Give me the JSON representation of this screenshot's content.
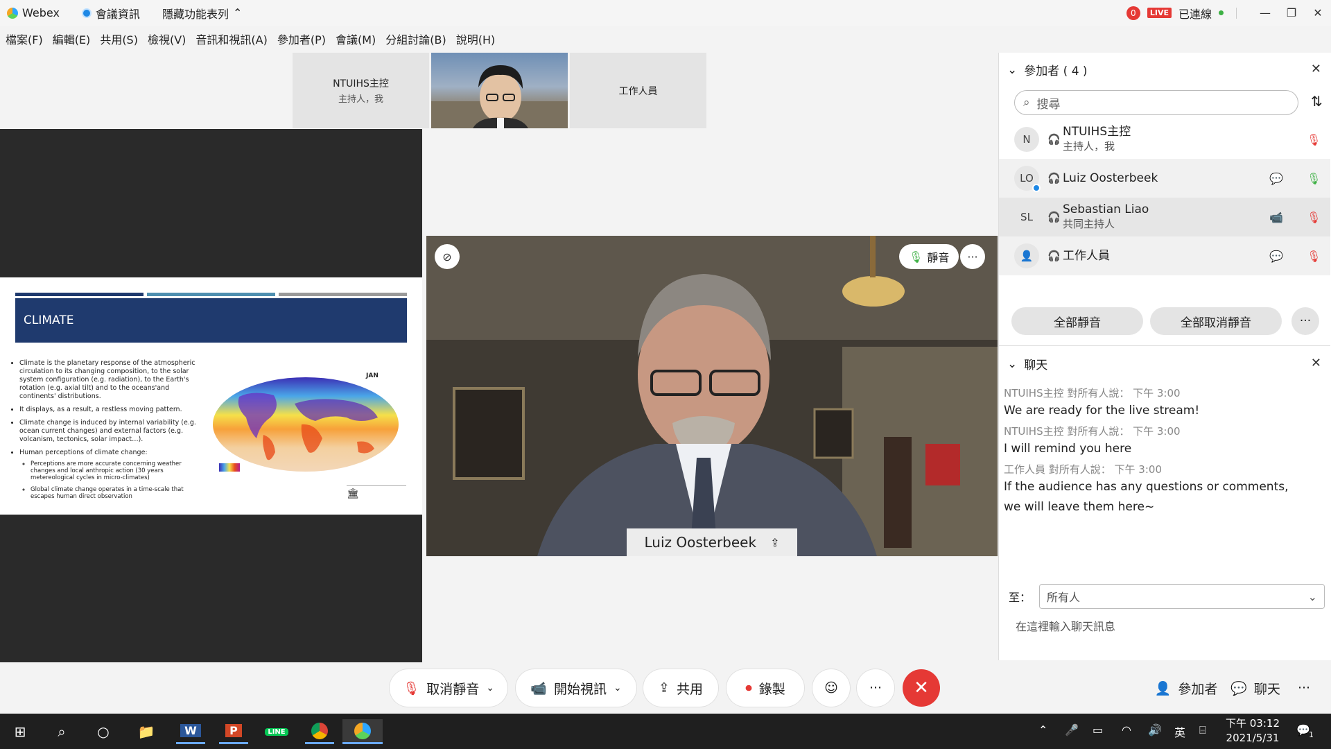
{
  "titlebar": {
    "app": "Webex",
    "meeting_info": "會議資訊",
    "hide_toolbar": "隱藏功能表列",
    "rec_count": "0",
    "live": "LIVE",
    "status": "已連線"
  },
  "menu": [
    "檔案(F)",
    "編輯(E)",
    "共用(S)",
    "檢視(V)",
    "音訊和視訊(A)",
    "參加者(P)",
    "會議(M)",
    "分組討論(B)",
    "說明(H)"
  ],
  "thumbnails": {
    "host_name": "NTUIHS主控",
    "host_sub": "主持人，我",
    "staff": "工作人員"
  },
  "slide": {
    "title": "CLIMATE",
    "bullets": [
      "Climate is the planetary response of the atmospheric circulation to its changing composition, to the solar system configuration (e.g. radiation), to the Earth's rotation (e.g. axial tilt) and to the oceans'and continents' distributions.",
      "It displays, as a result, a restless moving pattern.",
      "Climate change is induced by internal variability (e.g. ocean current changes) and external factors (e.g. volcanism, tectonics, solar impact…).",
      "Human perceptions of climate change:"
    ],
    "sub_bullets": [
      "Perceptions are more accurate concerning weather changes and local anthropic action (30 years metereological cycles in micro-climates)",
      "Global climate change operates in a time-scale that escapes human direct observation"
    ],
    "map_label": "JAN"
  },
  "main_video": {
    "mute_label": "靜音",
    "speaker_name": "Luiz Oosterbeek"
  },
  "participants": {
    "header": "參加者 ( 4 )",
    "search_placeholder": "搜尋",
    "list": [
      {
        "initials": "N",
        "name": "NTUIHS主控",
        "role": "主持人，我"
      },
      {
        "initials": "LO",
        "name": "Luiz Oosterbeek",
        "role": ""
      },
      {
        "initials": "SL",
        "name": "Sebastian Liao",
        "role": "共同主持人"
      },
      {
        "initials": "",
        "name": "工作人員",
        "role": ""
      }
    ],
    "mute_all": "全部靜音",
    "unmute_all": "全部取消靜音"
  },
  "chat": {
    "header": "聊天",
    "messages": [
      {
        "meta": "NTUIHS主控 對所有人說：   下午 3:00",
        "text": "We are ready for the live stream!"
      },
      {
        "meta": "NTUIHS主控 對所有人說：   下午 3:00",
        "text": "I will remind you here"
      },
      {
        "meta": "工作人員 對所有人說：   下午 3:00",
        "text": "If the audience has any questions or comments, we will leave them here~"
      }
    ],
    "to_label": "至：",
    "to_value": "所有人",
    "input_placeholder": "在這裡輸入聊天訊息"
  },
  "controls": {
    "unmute": "取消靜音",
    "start_video": "開始視訊",
    "share": "共用",
    "record": "錄製",
    "participants": "參加者",
    "chat": "聊天"
  },
  "taskbar": {
    "ime": "英",
    "time": "下午 03:12",
    "date": "2021/5/31",
    "notifications": "1"
  },
  "colors": {
    "accent_red": "#e53935",
    "slide_navy": "#1f3a6e",
    "status_green": "#3cb043"
  }
}
